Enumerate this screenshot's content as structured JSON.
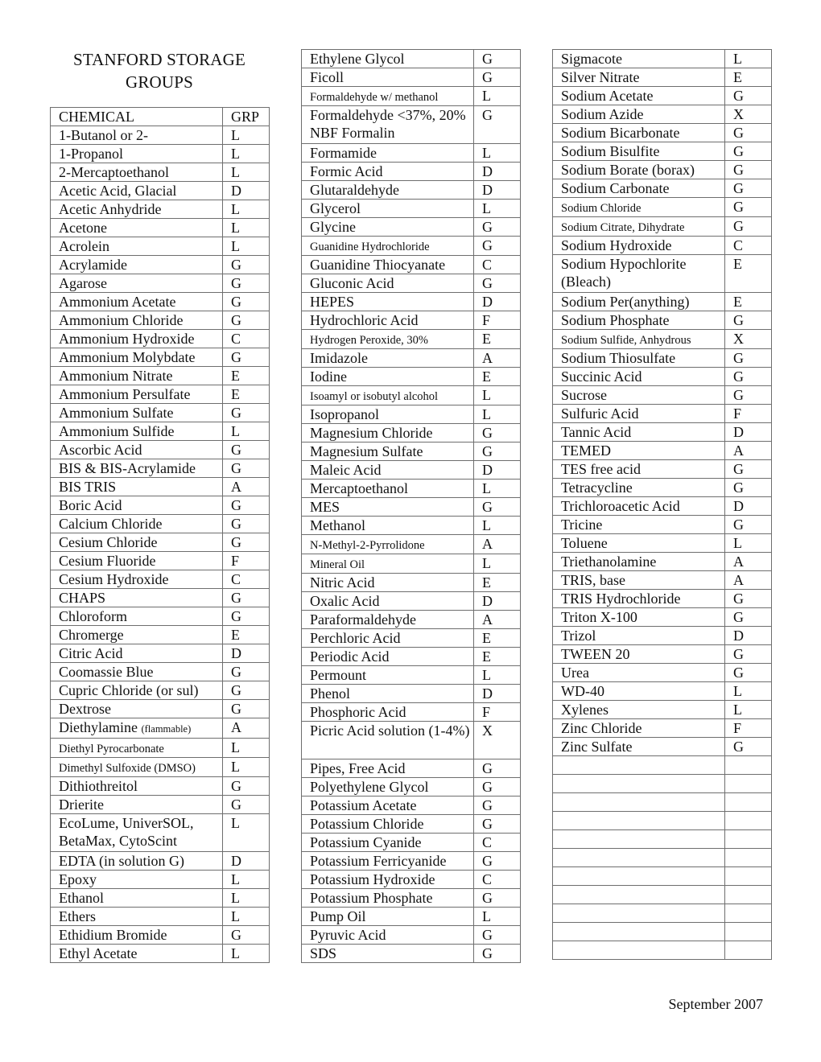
{
  "title_line1": "STANFORD STORAGE",
  "title_line2": "GROUPS",
  "header": {
    "chemical": "CHEMICAL",
    "group": "GRP"
  },
  "footer_date": "September 2007",
  "column1": [
    {
      "name": "1-Butanol or 2-",
      "grp": "L"
    },
    {
      "name": "1-Propanol",
      "grp": "L"
    },
    {
      "name": "2-Mercaptoethanol",
      "grp": "L"
    },
    {
      "name": "Acetic Acid, Glacial",
      "grp": "D"
    },
    {
      "name": "Acetic Anhydride",
      "grp": "L"
    },
    {
      "name": "Acetone",
      "grp": "L"
    },
    {
      "name": "Acrolein",
      "grp": "L"
    },
    {
      "name": "Acrylamide",
      "grp": "G"
    },
    {
      "name": "Agarose",
      "grp": "G"
    },
    {
      "name": "Ammonium Acetate",
      "grp": "G"
    },
    {
      "name": "Ammonium Chloride",
      "grp": "G"
    },
    {
      "name": "Ammonium Hydroxide",
      "grp": "C"
    },
    {
      "name": "Ammonium Molybdate",
      "grp": "G"
    },
    {
      "name": "Ammonium Nitrate",
      "grp": "E"
    },
    {
      "name": "Ammonium Persulfate",
      "grp": "E"
    },
    {
      "name": "Ammonium Sulfate",
      "grp": "G"
    },
    {
      "name": "Ammonium Sulfide",
      "grp": "L"
    },
    {
      "name": "Ascorbic Acid",
      "grp": "G"
    },
    {
      "name": "BIS & BIS-Acrylamide",
      "grp": "G"
    },
    {
      "name": "BIS TRIS",
      "grp": "A"
    },
    {
      "name": "Boric Acid",
      "grp": "G"
    },
    {
      "name": "Calcium Chloride",
      "grp": "G"
    },
    {
      "name": "Cesium Chloride",
      "grp": "G"
    },
    {
      "name": "Cesium Fluoride",
      "grp": "F"
    },
    {
      "name": "Cesium Hydroxide",
      "grp": "C"
    },
    {
      "name": "CHAPS",
      "grp": "G"
    },
    {
      "name": "Chloroform",
      "grp": "G"
    },
    {
      "name": "Chromerge",
      "grp": "E"
    },
    {
      "name": "Citric Acid",
      "grp": "D"
    },
    {
      "name": "Coomassie Blue",
      "grp": "G"
    },
    {
      "name": "Cupric Chloride (or sul)",
      "grp": "G"
    },
    {
      "name": "Dextrose",
      "grp": "G"
    },
    {
      "name": "Diethylamine",
      "note": "(flammable)",
      "grp": "A"
    },
    {
      "name": "Diethyl Pyrocarbonate",
      "grp": "L",
      "size": "small"
    },
    {
      "name": "Dimethyl Sulfoxide (DMSO)",
      "grp": "L",
      "size": "small"
    },
    {
      "name": "Dithiothreitol",
      "grp": "G"
    },
    {
      "name": "Drierite",
      "grp": "G"
    },
    {
      "name": "EcoLume, UniverSOL, BetaMax, CytoScint",
      "grp": "L",
      "tall": true
    },
    {
      "name": "EDTA (in solution G)",
      "grp": "D"
    },
    {
      "name": "Epoxy",
      "grp": "L"
    },
    {
      "name": "Ethanol",
      "grp": "L"
    },
    {
      "name": "Ethers",
      "grp": "L"
    },
    {
      "name": "Ethidium Bromide",
      "grp": "G"
    },
    {
      "name": "Ethyl Acetate",
      "grp": "L"
    }
  ],
  "column2": [
    {
      "name": "Ethylene Glycol",
      "grp": "G"
    },
    {
      "name": "Ficoll",
      "grp": "G"
    },
    {
      "name": "Formaldehyde w/ methanol",
      "grp": "L",
      "size": "small"
    },
    {
      "name": "Formaldehyde <37%, 20% NBF Formalin",
      "grp": "G",
      "tall": true
    },
    {
      "name": "Formamide",
      "grp": "L"
    },
    {
      "name": "Formic Acid",
      "grp": "D"
    },
    {
      "name": "Glutaraldehyde",
      "grp": "D"
    },
    {
      "name": "Glycerol",
      "grp": "L"
    },
    {
      "name": "Glycine",
      "grp": "G"
    },
    {
      "name": "Guanidine Hydrochloride",
      "grp": "G",
      "size": "small"
    },
    {
      "name": "Guanidine Thiocyanate",
      "grp": "C"
    },
    {
      "name": "Gluconic Acid",
      "grp": "G"
    },
    {
      "name": "HEPES",
      "grp": "D"
    },
    {
      "name": "Hydrochloric Acid",
      "grp": "F"
    },
    {
      "name": "Hydrogen Peroxide, 30%",
      "grp": "E",
      "size": "small"
    },
    {
      "name": "Imidazole",
      "grp": "A"
    },
    {
      "name": "Iodine",
      "grp": "E"
    },
    {
      "name": "Isoamyl or isobutyl alcohol",
      "grp": "L",
      "size": "small"
    },
    {
      "name": "Isopropanol",
      "grp": "L"
    },
    {
      "name": "Magnesium Chloride",
      "grp": "G"
    },
    {
      "name": "Magnesium Sulfate",
      "grp": "G"
    },
    {
      "name": "Maleic Acid",
      "grp": "D"
    },
    {
      "name": "Mercaptoethanol",
      "grp": "L"
    },
    {
      "name": "MES",
      "grp": "G"
    },
    {
      "name": "Methanol",
      "grp": "L"
    },
    {
      "name": "N-Methyl-2-Pyrrolidone",
      "grp": "A",
      "size": "small"
    },
    {
      "name": "Mineral Oil",
      "grp": "L",
      "size": "small"
    },
    {
      "name": "Nitric Acid",
      "grp": "E"
    },
    {
      "name": "Oxalic Acid",
      "grp": "D"
    },
    {
      "name": "Paraformaldehyde",
      "grp": "A"
    },
    {
      "name": "Perchloric Acid",
      "grp": "E"
    },
    {
      "name": "Periodic Acid",
      "grp": "E"
    },
    {
      "name": "Permount",
      "grp": "L"
    },
    {
      "name": "Phenol",
      "grp": "D"
    },
    {
      "name": "Phosphoric Acid",
      "grp": "F"
    },
    {
      "name": "Picric Acid solution (1-4%)",
      "grp": "X",
      "tall": true
    },
    {
      "name": "Pipes, Free Acid",
      "grp": "G"
    },
    {
      "name": "Polyethylene Glycol",
      "grp": "G"
    },
    {
      "name": "Potassium Acetate",
      "grp": "G"
    },
    {
      "name": "Potassium Chloride",
      "grp": "G"
    },
    {
      "name": "Potassium Cyanide",
      "grp": "C"
    },
    {
      "name": "Potassium Ferricyanide",
      "grp": "G"
    },
    {
      "name": "Potassium Hydroxide",
      "grp": "C"
    },
    {
      "name": "Potassium Phosphate",
      "grp": "G"
    },
    {
      "name": "Pump Oil",
      "grp": "L"
    },
    {
      "name": "Pyruvic Acid",
      "grp": "G"
    },
    {
      "name": "SDS",
      "grp": "G"
    }
  ],
  "column3": [
    {
      "name": "Sigmacote",
      "grp": "L"
    },
    {
      "name": "Silver Nitrate",
      "grp": "E"
    },
    {
      "name": "Sodium Acetate",
      "grp": "G"
    },
    {
      "name": "Sodium Azide",
      "grp": "X"
    },
    {
      "name": "Sodium Bicarbonate",
      "grp": "G"
    },
    {
      "name": "Sodium Bisulfite",
      "grp": "G"
    },
    {
      "name": "Sodium Borate (borax)",
      "grp": "G"
    },
    {
      "name": "Sodium Carbonate",
      "grp": "G"
    },
    {
      "name": "Sodium Chloride",
      "grp": "G",
      "size": "small"
    },
    {
      "name": "Sodium Citrate, Dihydrate",
      "grp": "G",
      "size": "small"
    },
    {
      "name": "Sodium Hydroxide",
      "grp": "C"
    },
    {
      "name": "Sodium Hypochlorite (Bleach)",
      "grp": "E",
      "tall": true
    },
    {
      "name": "Sodium Per(anything)",
      "grp": "E"
    },
    {
      "name": "Sodium Phosphate",
      "grp": "G"
    },
    {
      "name": "Sodium Sulfide, Anhydrous",
      "grp": "X",
      "size": "small"
    },
    {
      "name": "Sodium Thiosulfate",
      "grp": "G"
    },
    {
      "name": "Succinic Acid",
      "grp": "G"
    },
    {
      "name": "Sucrose",
      "grp": "G"
    },
    {
      "name": "Sulfuric Acid",
      "grp": "F"
    },
    {
      "name": "Tannic Acid",
      "grp": "D"
    },
    {
      "name": "TEMED",
      "grp": "A"
    },
    {
      "name": "TES free acid",
      "grp": "G"
    },
    {
      "name": "Tetracycline",
      "grp": "G"
    },
    {
      "name": "Trichloroacetic Acid",
      "grp": "D"
    },
    {
      "name": "Tricine",
      "grp": "G"
    },
    {
      "name": "Toluene",
      "grp": "L"
    },
    {
      "name": "Triethanolamine",
      "grp": "A"
    },
    {
      "name": "TRIS, base",
      "grp": "A"
    },
    {
      "name": "TRIS Hydrochloride",
      "grp": "G"
    },
    {
      "name": "Triton X-100",
      "grp": "G"
    },
    {
      "name": "Trizol",
      "grp": "D"
    },
    {
      "name": "TWEEN 20",
      "grp": "G"
    },
    {
      "name": "Urea",
      "grp": "G"
    },
    {
      "name": "WD-40",
      "grp": "L"
    },
    {
      "name": "Xylenes",
      "grp": "L"
    },
    {
      "name": "Zinc Chloride",
      "grp": "F"
    },
    {
      "name": "Zinc Sulfate",
      "grp": "G"
    },
    {
      "name": "",
      "grp": ""
    },
    {
      "name": "",
      "grp": ""
    },
    {
      "name": "",
      "grp": ""
    },
    {
      "name": "",
      "grp": ""
    },
    {
      "name": "",
      "grp": ""
    },
    {
      "name": "",
      "grp": ""
    },
    {
      "name": "",
      "grp": ""
    },
    {
      "name": "",
      "grp": ""
    },
    {
      "name": "",
      "grp": ""
    },
    {
      "name": "",
      "grp": ""
    },
    {
      "name": "",
      "grp": ""
    }
  ]
}
